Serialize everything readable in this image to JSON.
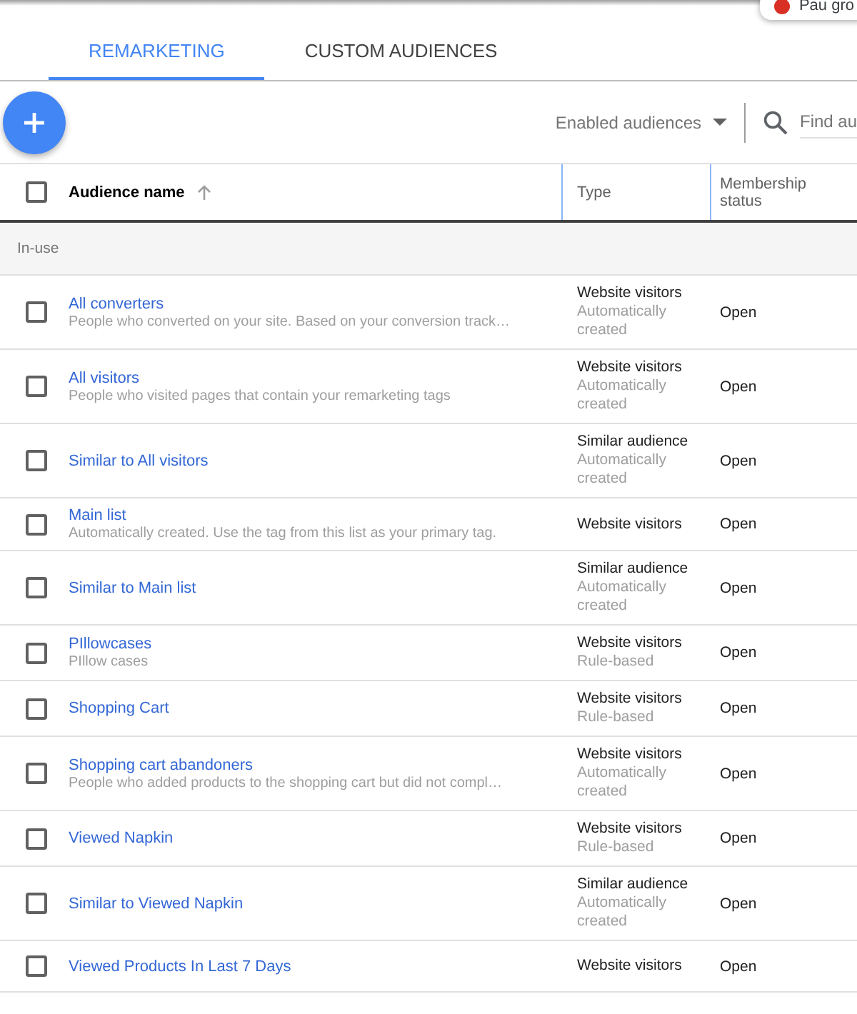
{
  "notification": {
    "text": "Pau gro"
  },
  "tabs": [
    {
      "label": "REMARKETING",
      "selected": true
    },
    {
      "label": "CUSTOM AUDIENCES",
      "selected": false
    }
  ],
  "toolbar": {
    "filter": "Enabled audiences",
    "search": {
      "placeholder": "Find au"
    }
  },
  "table": {
    "select_all_checked": false,
    "columns": [
      {
        "label": "Audience name",
        "sorted": true
      },
      {
        "label": "Type",
        "sorted": false
      },
      {
        "label": "Membership status",
        "sorted": false
      }
    ],
    "group": "In-use",
    "rows": [
      {
        "name": "All converters",
        "description": "People who converted on your site. Based on your conversion track…",
        "type": "Website visitors",
        "source": "Automatically created",
        "status": "Open",
        "checked": false
      },
      {
        "name": "All visitors",
        "description": "People who visited pages that contain your remarketing tags",
        "type": "Website visitors",
        "source": "Automatically created",
        "status": "Open",
        "checked": false
      },
      {
        "name": "Similar to All visitors",
        "type": "Similar audience",
        "source": "Automatically created",
        "status": "Open",
        "checked": false
      },
      {
        "name": "Main list",
        "description": "Automatically created. Use the tag from this list as your primary tag.",
        "type": "Website visitors",
        "status": "Open",
        "checked": false
      },
      {
        "name": "Similar to Main list",
        "type": "Similar audience",
        "source": "Automatically created",
        "status": "Open",
        "checked": false
      },
      {
        "name": "PIllowcases",
        "description": "PIllow cases",
        "type": "Website visitors",
        "source": "Rule-based",
        "status": "Open",
        "checked": false
      },
      {
        "name": "Shopping Cart",
        "type": "Website visitors",
        "source": "Rule-based",
        "status": "Open",
        "checked": false
      },
      {
        "name": "Shopping cart abandoners",
        "description": "People who added products to the shopping cart but did not compl…",
        "type": "Website visitors",
        "source": "Automatically created",
        "status": "Open",
        "checked": false
      },
      {
        "name": "Viewed Napkin",
        "type": "Website visitors",
        "source": "Rule-based",
        "status": "Open",
        "checked": false
      },
      {
        "name": "Similar to Viewed Napkin",
        "type": "Similar audience",
        "source": "Automatically created",
        "status": "Open",
        "checked": false
      },
      {
        "name": "Viewed Products In Last 7 Days",
        "type": "Website visitors",
        "status": "Open",
        "checked": false
      }
    ]
  }
}
